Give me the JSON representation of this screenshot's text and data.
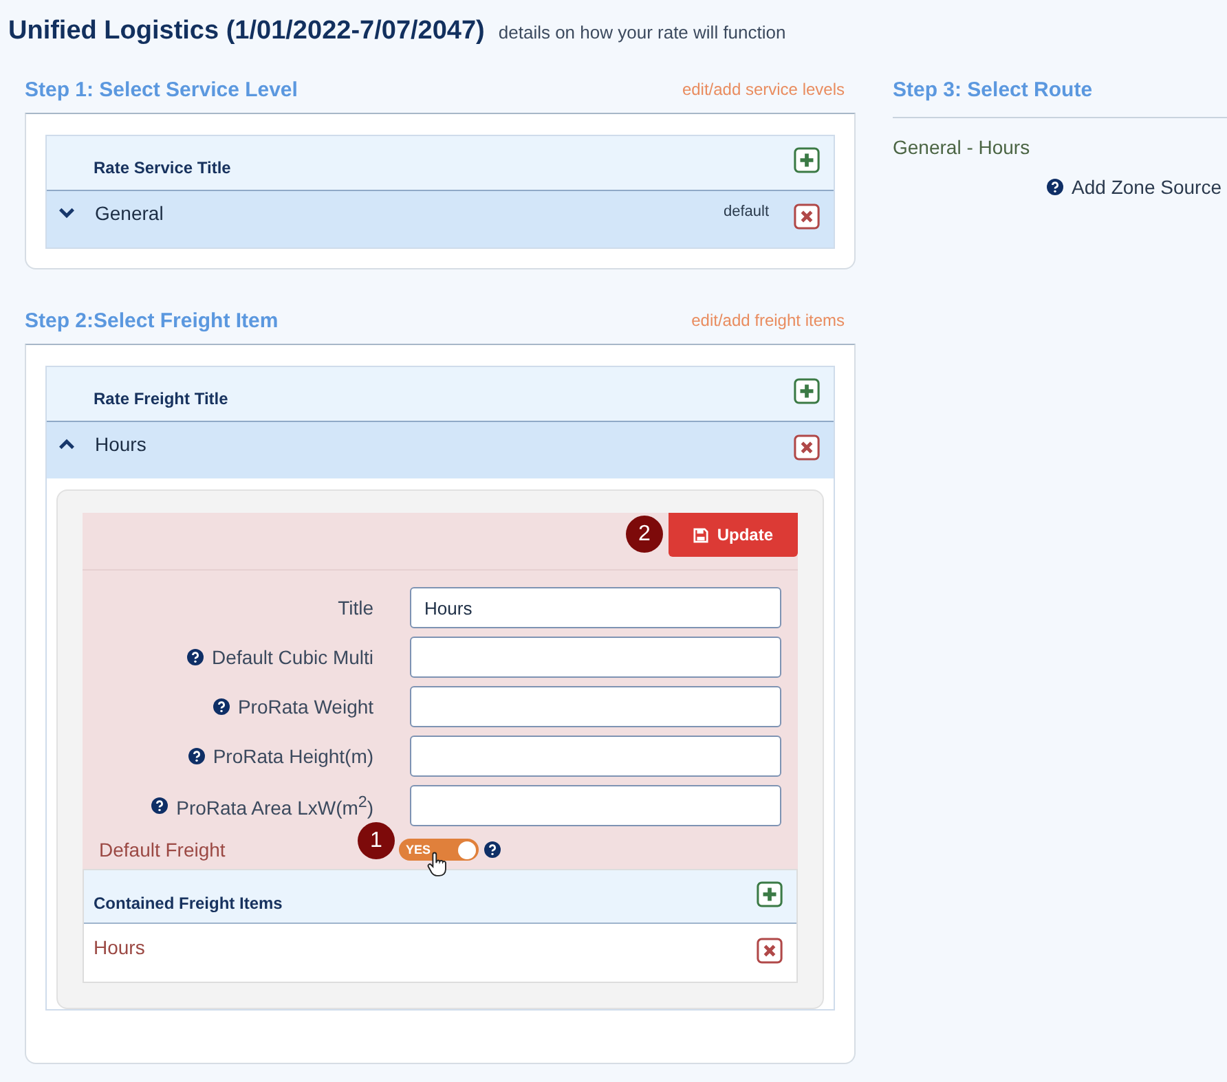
{
  "header": {
    "title": "Unified Logistics (1/01/2022-7/07/2047)",
    "subtitle": "details on how your rate will function"
  },
  "step1": {
    "title": "Step 1: Select Service Level",
    "link": "edit/add service levels",
    "column": "Rate Service Title",
    "rows": [
      {
        "title": "General",
        "note": "default",
        "expanded": false
      }
    ]
  },
  "step2": {
    "title": "Step 2:Select Freight Item",
    "link": "edit/add freight items",
    "column": "Rate Freight Title",
    "rows": [
      {
        "title": "Hours",
        "expanded": true
      }
    ],
    "form": {
      "update_button": "Update",
      "update_marker": "2",
      "fields": [
        {
          "label": "Title",
          "help": false,
          "value": "Hours"
        },
        {
          "label": "Default Cubic Multi",
          "help": true
        },
        {
          "label": "ProRata Weight",
          "help": true
        },
        {
          "label": "ProRata Height(m)",
          "help": true
        },
        {
          "label": "ProRata Area LxW(m$^{2}$)",
          "help": true
        }
      ],
      "toggle": {
        "label": "Default Freight",
        "on": true,
        "text": "YES",
        "marker": "1",
        "help": true
      },
      "contained": {
        "column": "Contained Freight Items",
        "rows": [
          "Hours"
        ]
      }
    }
  },
  "step3": {
    "title": "Step 3: Select Route",
    "route": "General - Hours",
    "action": "Add Zone Source"
  }
}
